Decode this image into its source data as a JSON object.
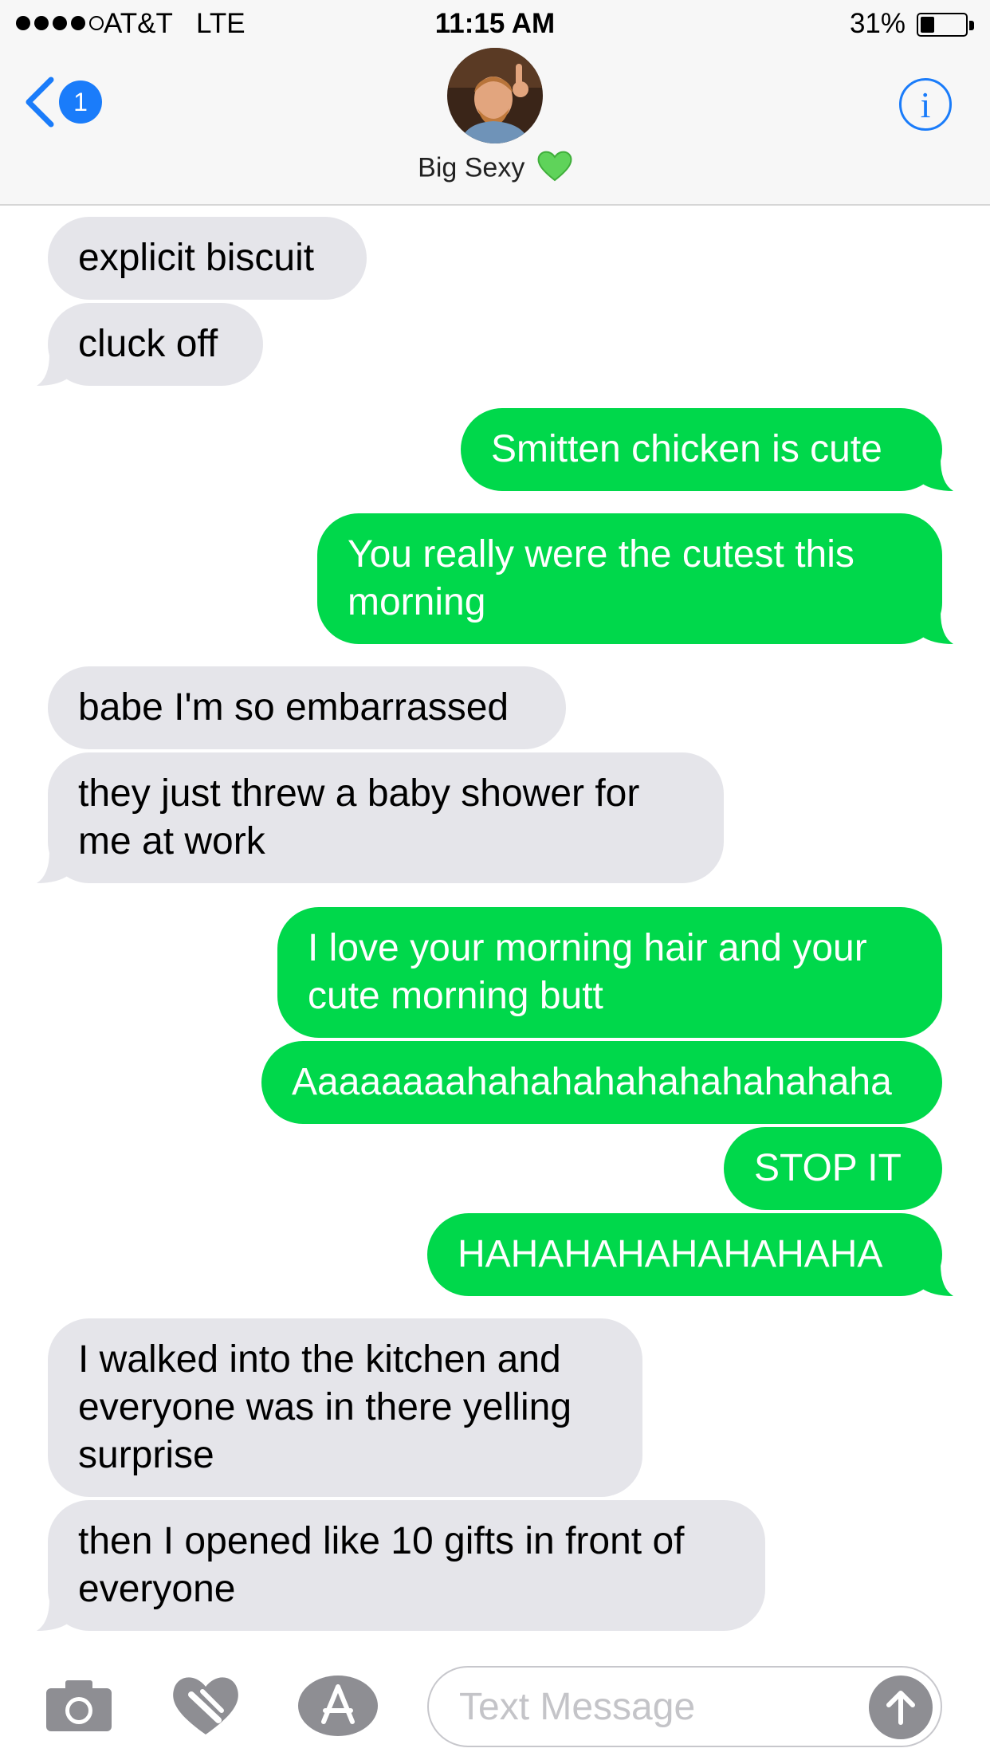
{
  "status_bar": {
    "carrier": "AT&T",
    "network": "LTE",
    "time": "11:15 AM",
    "battery_percent": "31%",
    "battery_level": 0.31
  },
  "nav": {
    "unread_count": "1",
    "contact_name": "Big Sexy",
    "contact_emoji": "green-heart-icon"
  },
  "messages": [
    {
      "sender": "contact",
      "text": [
        "explicit biscuit"
      ]
    },
    {
      "sender": "contact",
      "text": [
        "cluck off"
      ]
    },
    {
      "sender": "me",
      "text": [
        "Smitten chicken is cute"
      ]
    },
    {
      "sender": "me",
      "text": [
        " You really were the cutest this",
        "morning"
      ]
    },
    {
      "sender": "contact",
      "text": [
        "babe I'm so embarrassed"
      ]
    },
    {
      "sender": "contact",
      "text": [
        "they just threw a baby shower for",
        "me at work"
      ]
    },
    {
      "sender": "me",
      "text": [
        "I love your morning hair and your",
        "cute morning butt"
      ]
    },
    {
      "sender": "me",
      "text": [
        "Aaaaaaaahahahahahahahahahaha"
      ]
    },
    {
      "sender": "me",
      "text": [
        "STOP IT"
      ]
    },
    {
      "sender": "me",
      "text": [
        "HAHAHAHAHAHAHAHA"
      ]
    },
    {
      "sender": "contact",
      "text": [
        "I walked into the kitchen and",
        "everyone was in there yelling",
        "surprise"
      ]
    },
    {
      "sender": "contact",
      "text": [
        "then I opened like 10 gifts in front of",
        "everyone"
      ]
    }
  ],
  "input": {
    "placeholder": "Text Message"
  },
  "colors": {
    "outgoing": "#00d84b",
    "incoming": "#e5e5ea",
    "accent": "#1a7cfa"
  }
}
